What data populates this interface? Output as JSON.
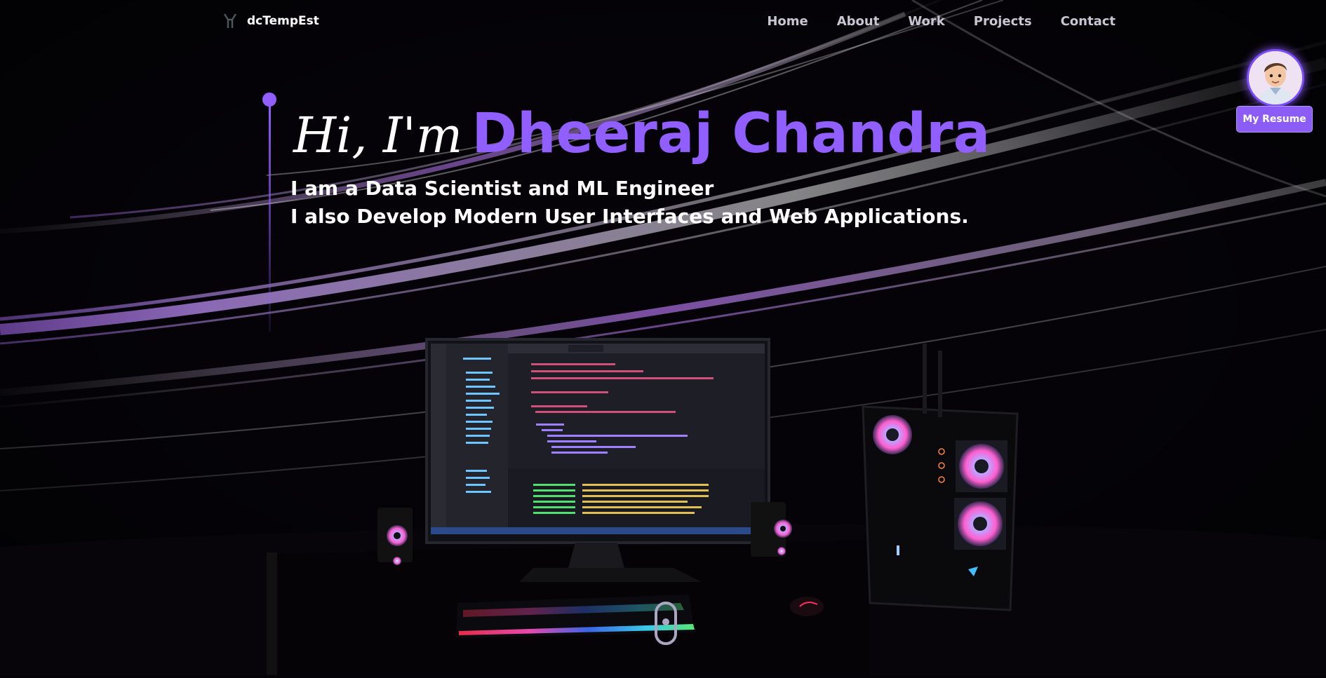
{
  "brand": {
    "name": "dcTempEst",
    "logo_icon": "logo-mark-icon"
  },
  "nav": {
    "items": [
      {
        "label": "Home"
      },
      {
        "label": "About"
      },
      {
        "label": "Work"
      },
      {
        "label": "Projects"
      },
      {
        "label": "Contact"
      }
    ]
  },
  "profile": {
    "avatar_icon": "avatar-icon",
    "resume_label": "My Resume"
  },
  "hero": {
    "greeting": "Hi, I'm",
    "name": "Dheeraj Chandra",
    "line1": "I am a Data Scientist and ML Engineer",
    "line2": "I also Develop Modern User Interfaces and Web Applications."
  },
  "scene": {
    "description_icon": "desktop-pc-3d-model"
  },
  "colors": {
    "accent": "#915eff",
    "background": "#050308",
    "text": "#ffffff",
    "nav_text": "#c9c6d3"
  }
}
